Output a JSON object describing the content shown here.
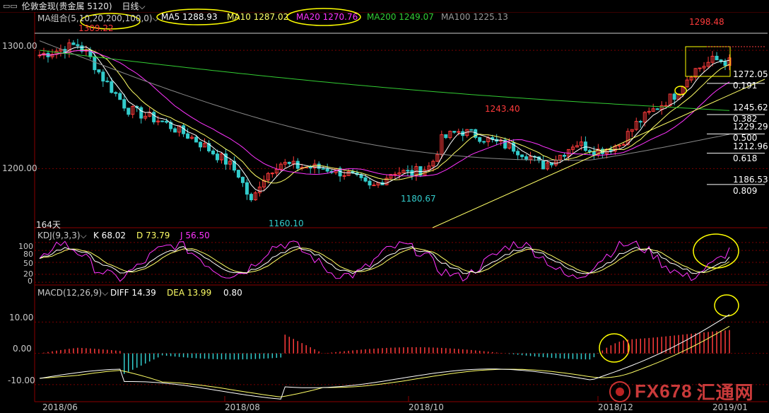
{
  "window": {
    "title": "伦敦金现(贵金属 5120)",
    "period": "日线"
  },
  "icons": {
    "menu": "window-icon",
    "period_dropdown": "chevron-down-icon",
    "watermark_logo": "fx678-logo-icon"
  },
  "colors": {
    "up": "#ff3b3b",
    "down": "#33cccc",
    "ma5": "#ffffff",
    "ma10": "#ffff66",
    "ma20": "#ff33ff",
    "ma200": "#33cc33",
    "ma100": "#888888",
    "grid": "#7a0000",
    "trend": "#ffff66",
    "highlight": "#ffff00"
  },
  "main_panel": {
    "legend": {
      "group": "MA组合(5,10,20,200,100,0)",
      "ma5": "MA5 1288.93",
      "ma10": "MA10 1287.02",
      "ma20": "MA20 1270.76",
      "ma200": "MA200 1249.07",
      "ma100": "MA100 1225.13"
    },
    "y_ticks": [
      "1300.00",
      "1200.00"
    ],
    "days_label": "164天",
    "annotations": {
      "high_left": "1309.22",
      "low_a": "1160.10",
      "low_b": "1180.67",
      "peak_mid": "1243.40",
      "high_right": "1298.48"
    },
    "fib_levels": [
      {
        "price": "1272.05",
        "ratio": "0.191"
      },
      {
        "price": "1245.62",
        "ratio": "0.382"
      },
      {
        "price": "1229.29",
        "ratio": "0.500"
      },
      {
        "price": "1212.96",
        "ratio": "0.618"
      },
      {
        "price": "1186.53",
        "ratio": "0.809"
      }
    ]
  },
  "kdj_panel": {
    "title": "KDJ(9,3,3)",
    "k": "K 68.02",
    "d": "D 73.79",
    "j": "J 56.50",
    "y_ticks": [
      "100",
      "80",
      "50",
      "20",
      "0"
    ]
  },
  "macd_panel": {
    "title": "MACD(12,26,9)",
    "diff": "DIFF 14.39",
    "dea": "DEA 13.99",
    "macd": "0.80",
    "y_ticks": [
      "10.00",
      "0.00",
      "-10.00"
    ]
  },
  "x_axis": {
    "labels": [
      "2018/06",
      "2018/08",
      "2018/10",
      "2018/12",
      "2019/01"
    ]
  },
  "watermark": {
    "brand": "FX678",
    "cn": "汇通网"
  },
  "chart_data": {
    "type": "candlestick",
    "title": "伦敦金现(贵金属 5120) 日线",
    "price_anchors": [
      {
        "date": "2018/06",
        "close": 1300
      },
      {
        "date": "2018/06 high",
        "high": 1309.22
      },
      {
        "date": "2018/08 low",
        "low": 1160.1
      },
      {
        "date": "2018/09 low",
        "low": 1180.67
      },
      {
        "date": "2018/10 high",
        "high": 1243.4
      },
      {
        "date": "2019/01 high",
        "high": 1298.48
      }
    ],
    "moving_averages": {
      "MA5": 1288.93,
      "MA10": 1287.02,
      "MA20": 1270.76,
      "MA200": 1249.07,
      "MA100": 1225.13
    },
    "kdj": {
      "K": 68.02,
      "D": 73.79,
      "J": 56.5
    },
    "macd": {
      "DIFF": 14.39,
      "DEA": 13.99,
      "MACD": 0.8
    },
    "fibonacci": [
      {
        "level": 0.191,
        "price": 1272.05
      },
      {
        "level": 0.382,
        "price": 1245.62
      },
      {
        "level": 0.5,
        "price": 1229.29
      },
      {
        "level": 0.618,
        "price": 1212.96
      },
      {
        "level": 0.809,
        "price": 1186.53
      }
    ],
    "ylim_price": [
      1150,
      1315
    ],
    "ylim_kdj": [
      0,
      100
    ],
    "ylim_macd": [
      -15,
      18
    ]
  }
}
